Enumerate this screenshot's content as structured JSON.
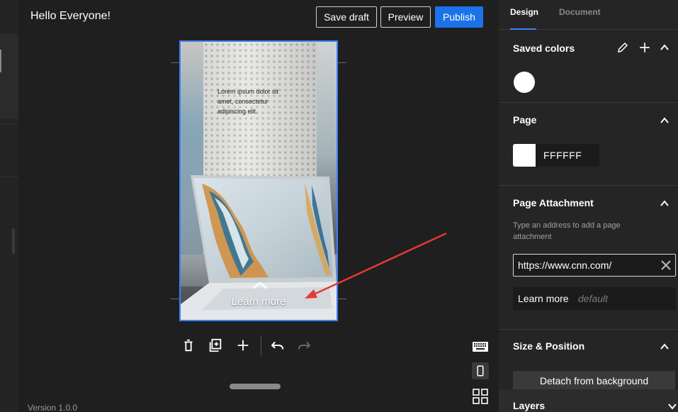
{
  "header": {
    "title": "Hello Everyone!",
    "save_draft": "Save draft",
    "preview": "Preview",
    "publish": "Publish"
  },
  "page": {
    "body_text": "Lorem ipsum dolor sit amet, consectetur adipiscing elit.",
    "cta_label": "Learn more"
  },
  "toolbar": {
    "icons": [
      "trash-icon",
      "duplicate-icon",
      "add-icon",
      "undo-icon",
      "redo-icon"
    ]
  },
  "side_tools": [
    "keyboard-icon",
    "mobile-icon",
    "grid-icon"
  ],
  "footer": {
    "version": "Version 1.0.0"
  },
  "panel": {
    "tabs": {
      "design": "Design",
      "document": "Document"
    },
    "saved_colors": {
      "title": "Saved colors",
      "swatch": "#FFFFFF"
    },
    "page_section": {
      "title": "Page",
      "color_value": "FFFFFF"
    },
    "page_attachment": {
      "title": "Page Attachment",
      "help": "Type an address to add a page attachment",
      "url_value": "https://www.cnn.com/",
      "label_value": "Learn more",
      "label_placeholder": "default"
    },
    "size_position": {
      "title": "Size & Position",
      "detach": "Detach from background"
    },
    "layers": {
      "title": "Layers"
    }
  },
  "colors": {
    "accent": "#1a73e8",
    "selection": "#3b82f6",
    "annotation_arrow": "#e53935"
  }
}
